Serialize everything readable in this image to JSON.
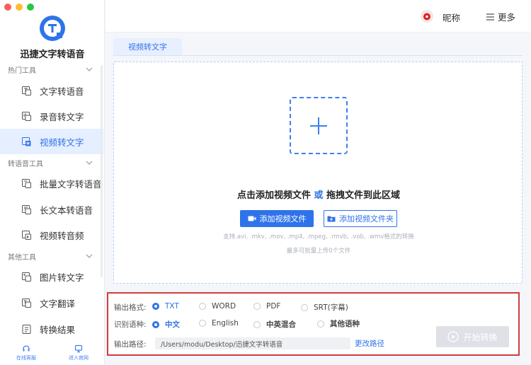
{
  "app": {
    "title": "迅捷文字转语音"
  },
  "header": {
    "nickname": "昵称",
    "more_label": "更多"
  },
  "sidebar": {
    "sections": [
      {
        "label": "热门工具",
        "items": [
          {
            "label": "文字转语音",
            "icon": "text-to-speech-icon"
          },
          {
            "label": "录音转文字",
            "icon": "recording-to-text-icon"
          },
          {
            "label": "视频转文字",
            "icon": "video-to-text-icon",
            "active": true
          }
        ]
      },
      {
        "label": "转语音工具",
        "items": [
          {
            "label": "批量文字转语音",
            "icon": "batch-text-to-speech-icon"
          },
          {
            "label": "长文本转语音",
            "icon": "long-text-to-speech-icon"
          },
          {
            "label": "视频转音频",
            "icon": "video-to-audio-icon"
          }
        ]
      },
      {
        "label": "其他工具",
        "items": [
          {
            "label": "图片转文字",
            "icon": "image-to-text-icon"
          },
          {
            "label": "文字翻译",
            "icon": "translate-icon"
          },
          {
            "label": "转换结果",
            "icon": "results-icon"
          }
        ]
      }
    ],
    "bottom": {
      "service_label": "在线客服",
      "website_label": "进入官网"
    }
  },
  "tabs": [
    {
      "label": "视频转文字",
      "active": true
    }
  ],
  "dropzone": {
    "title_part1": "点击添加视频文件",
    "title_or": "或",
    "title_part2": "拖拽文件到此区域",
    "add_file_button": "添加视频文件",
    "add_folder_button": "添加视频文件夹",
    "formats_hint": "支持.avi, .mkv, .mov, .mp4, .mpeg, .rmvb, .vob, .wmv格式的转换",
    "limit_hint": "最多可批量上传0个文件"
  },
  "options": {
    "output_format": {
      "label": "输出格式:",
      "options": [
        "TXT",
        "WORD",
        "PDF",
        "SRT(字幕)"
      ],
      "selected": "TXT"
    },
    "language": {
      "label": "识别语种:",
      "options": [
        "中文",
        "English",
        "中英混合",
        "其他语种"
      ],
      "selected": "中文"
    },
    "output_path": {
      "label": "输出路径:",
      "value": "/Users/modu/Desktop/迅捷文字转语音",
      "change_label": "更改路径"
    },
    "start_button": "开始转换"
  },
  "colors": {
    "accent": "#2f73ea",
    "highlight_border": "#d23c3c"
  }
}
